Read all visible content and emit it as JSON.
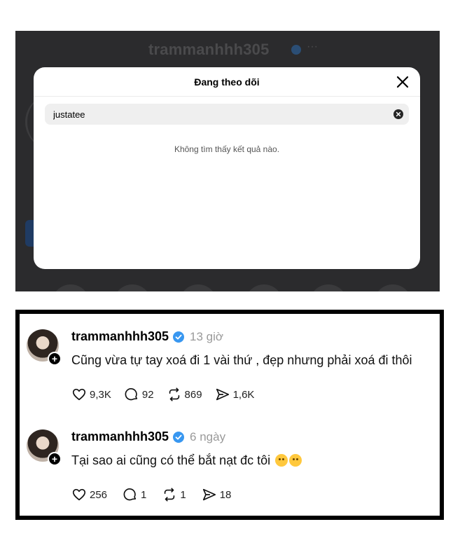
{
  "background_profile": {
    "username": "trammanhhh305",
    "more_label": "···"
  },
  "modal": {
    "title": "Đang theo dõi",
    "search": {
      "value": "justatee",
      "placeholder": "Tìm kiếm"
    },
    "empty_message": "Không tìm thấy kết quả nào."
  },
  "posts": [
    {
      "username": "trammanhhh305",
      "time": "13 giờ",
      "text": "Cũng vừa tự tay xoá đi 1 vài thứ , đẹp nhưng phải xoá đi thôi",
      "likes": "9,3K",
      "replies": "92",
      "reposts": "869",
      "shares": "1,6K"
    },
    {
      "username": "trammanhhh305",
      "time": "6 ngày",
      "text": "Tại sao ai cũng có thể bắt nạt đc tôi",
      "likes": "256",
      "replies": "1",
      "reposts": "1",
      "shares": "18"
    }
  ],
  "colors": {
    "verified": "#3897f0",
    "modal_bg": "#ffffff",
    "dim_bg": "#2b2b2d"
  }
}
